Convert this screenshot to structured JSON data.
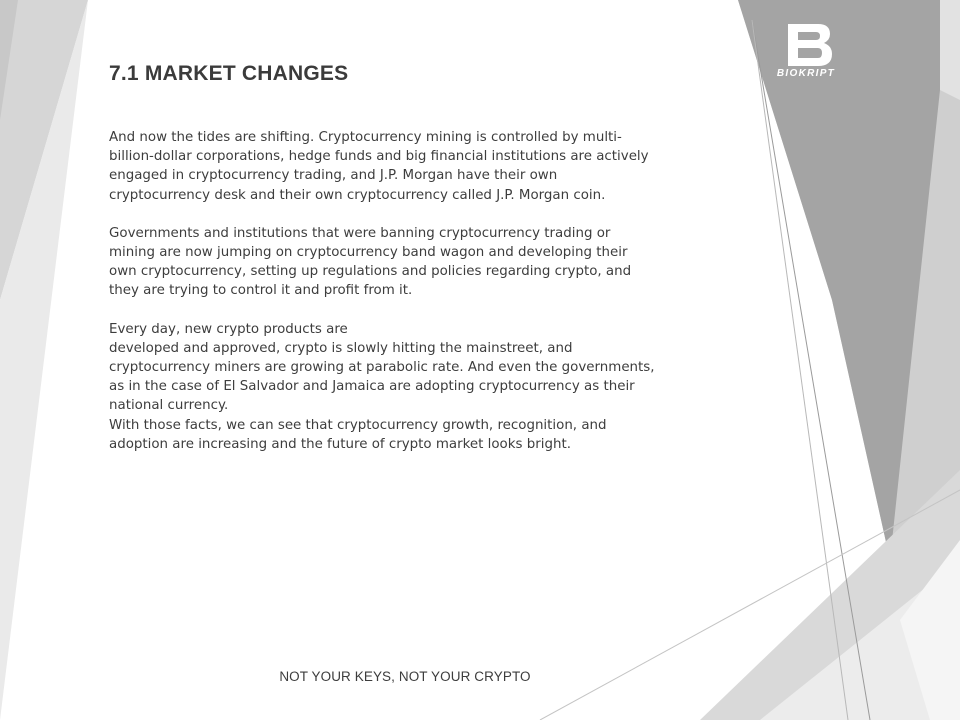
{
  "slide": {
    "title": "7.1 MARKET CHANGES",
    "paragraphs": [
      [
        "And now the tides are shifting. Cryptocurrency mining is controlled by multi-",
        "billion-dollar corporations, hedge funds and big financial institutions are actively",
        "engaged in cryptocurrency trading, and J.P. Morgan have their own",
        "cryptocurrency desk and their own cryptocurrency called J.P. Morgan coin."
      ],
      [
        "Governments and institutions that were banning cryptocurrency trading or",
        "mining are now jumping on cryptocurrency band wagon and developing their",
        "own cryptocurrency, setting up regulations and policies regarding crypto, and",
        "they are trying to control it and profit from it."
      ],
      [
        "Every day, new crypto products are",
        "developed and approved, crypto is slowly hitting the mainstreet, and",
        "cryptocurrency miners are growing at parabolic rate. And even the governments,",
        "as in the case of El Salvador and Jamaica are adopting cryptocurrency as their",
        "national currency.",
        "With those facts, we can see that cryptocurrency growth, recognition, and",
        "adoption are increasing and the future of crypto market looks bright."
      ]
    ],
    "footer": "NOT YOUR KEYS, NOT YOUR CRYPTO"
  },
  "logo": {
    "letter": "B",
    "text": "BIOKRIPT",
    "color": "#ffffff"
  },
  "colors": {
    "title": "#3b3b3b",
    "body": "#3d3d3d",
    "background": "#ffffff"
  }
}
